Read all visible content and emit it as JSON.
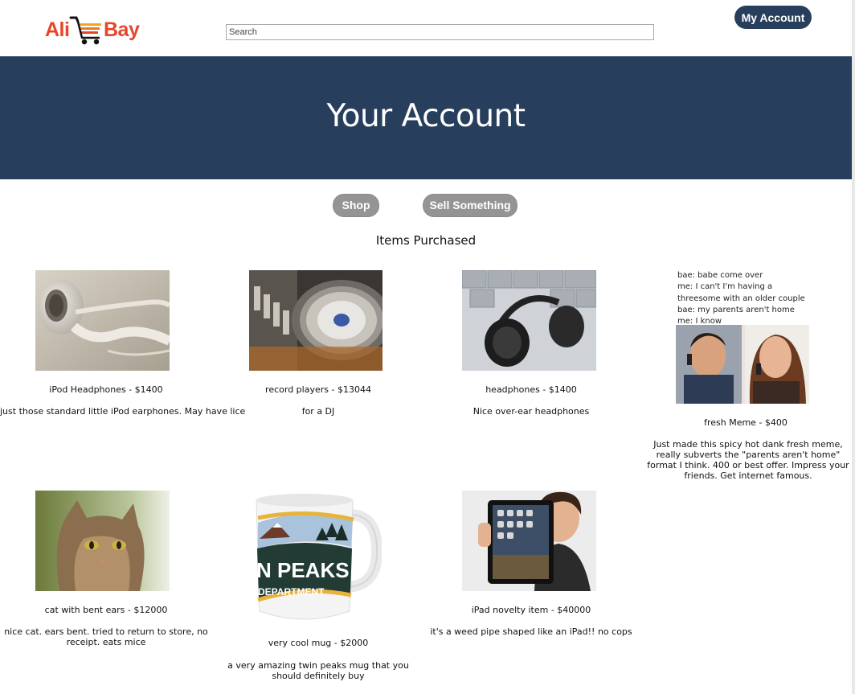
{
  "header": {
    "logo_left": "Ali",
    "logo_right": "Bay",
    "search_placeholder": "Search",
    "account_label": "My Account"
  },
  "banner": {
    "title": "Your Account"
  },
  "nav": {
    "shop_label": "Shop",
    "sell_label": "Sell Something"
  },
  "section_title": "Items Purchased",
  "items": [
    {
      "caption": "iPod Headphones - $1400",
      "description": "just those standard little iPod earphones. May have lice"
    },
    {
      "caption": "record players - $13044",
      "description": "for a DJ"
    },
    {
      "caption": "headphones - $1400",
      "description": "Nice over-ear headphones"
    },
    {
      "caption": "fresh Meme - $400",
      "description": "Just made this spicy hot dank fresh meme, really subverts the \"parents aren't home\" format I think. 400 or best offer. Impress your friends. Get internet famous.",
      "meme_lines": [
        "bae: babe come over",
        "me: I can't I'm having a",
        "threesome with an older couple",
        "bae: my parents aren't home",
        "me: I know"
      ]
    },
    {
      "caption": "cat with bent ears - $12000",
      "description": "nice cat. ears bent. tried to return to store, no receipt. eats mice"
    },
    {
      "caption": "very cool mug - $2000",
      "description": "a very amazing twin peaks mug that you should definitely buy",
      "mug_text_1": "N PEAKS",
      "mug_text_2": "DEPARTMENT"
    },
    {
      "caption": "iPad novelty item - $40000",
      "description": "it's a weed pipe shaped like an iPad!! no cops"
    }
  ],
  "colors": {
    "brand_navy": "#273f5c",
    "logo_red": "#e8452a",
    "pill_gray": "#949494"
  }
}
